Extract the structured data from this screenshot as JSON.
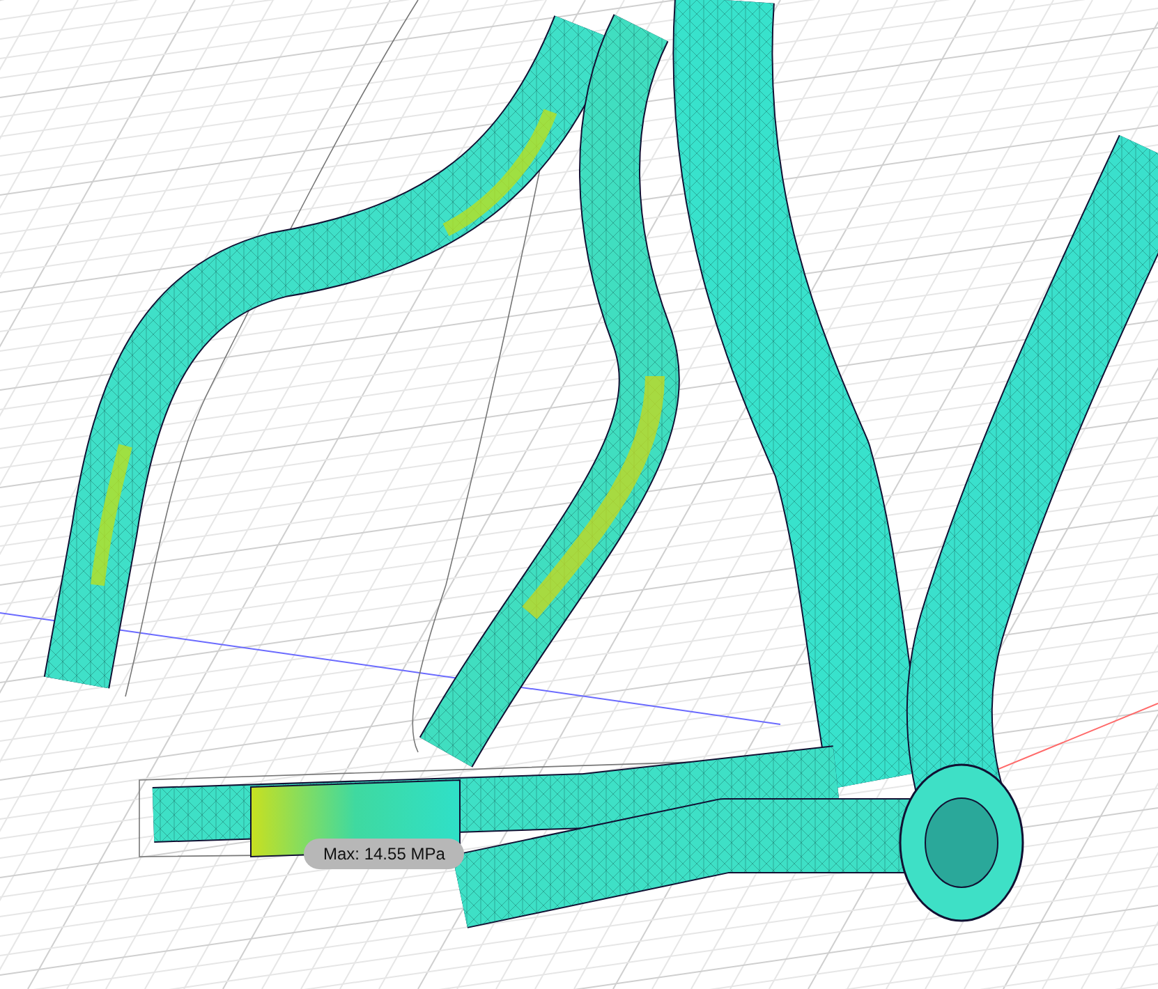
{
  "viewport": {
    "max_stress_label": "Max: 14.55 MPa"
  }
}
